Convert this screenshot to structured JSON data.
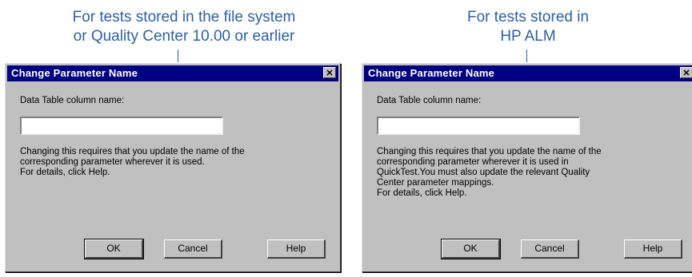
{
  "captions": {
    "left": [
      "For tests stored in the file system",
      "or Quality Center 10.00 or earlier"
    ],
    "right": [
      "For tests stored in",
      "HP ALM"
    ]
  },
  "left_dialog": {
    "title": "Change Parameter Name",
    "close_glyph": "✕",
    "field_label": "Data Table column name:",
    "field_value": "",
    "description": [
      "Changing this requires that you update the name of the",
      "corresponding parameter wherever it is used.",
      "For details, click Help."
    ],
    "buttons": {
      "ok": "OK",
      "cancel": "Cancel",
      "help": "Help"
    }
  },
  "right_dialog": {
    "title": "Change Parameter Name",
    "close_glyph": "✕",
    "field_label": "Data Table column name:",
    "field_value": "",
    "description": [
      "Changing this requires that you update the name of the",
      "corresponding parameter wherever it is used in",
      "QuickTest.You must also update the relevant Quality",
      "Center parameter mappings.",
      "For details, click Help."
    ],
    "buttons": {
      "ok": "OK",
      "cancel": "Cancel",
      "help": "Help"
    }
  }
}
